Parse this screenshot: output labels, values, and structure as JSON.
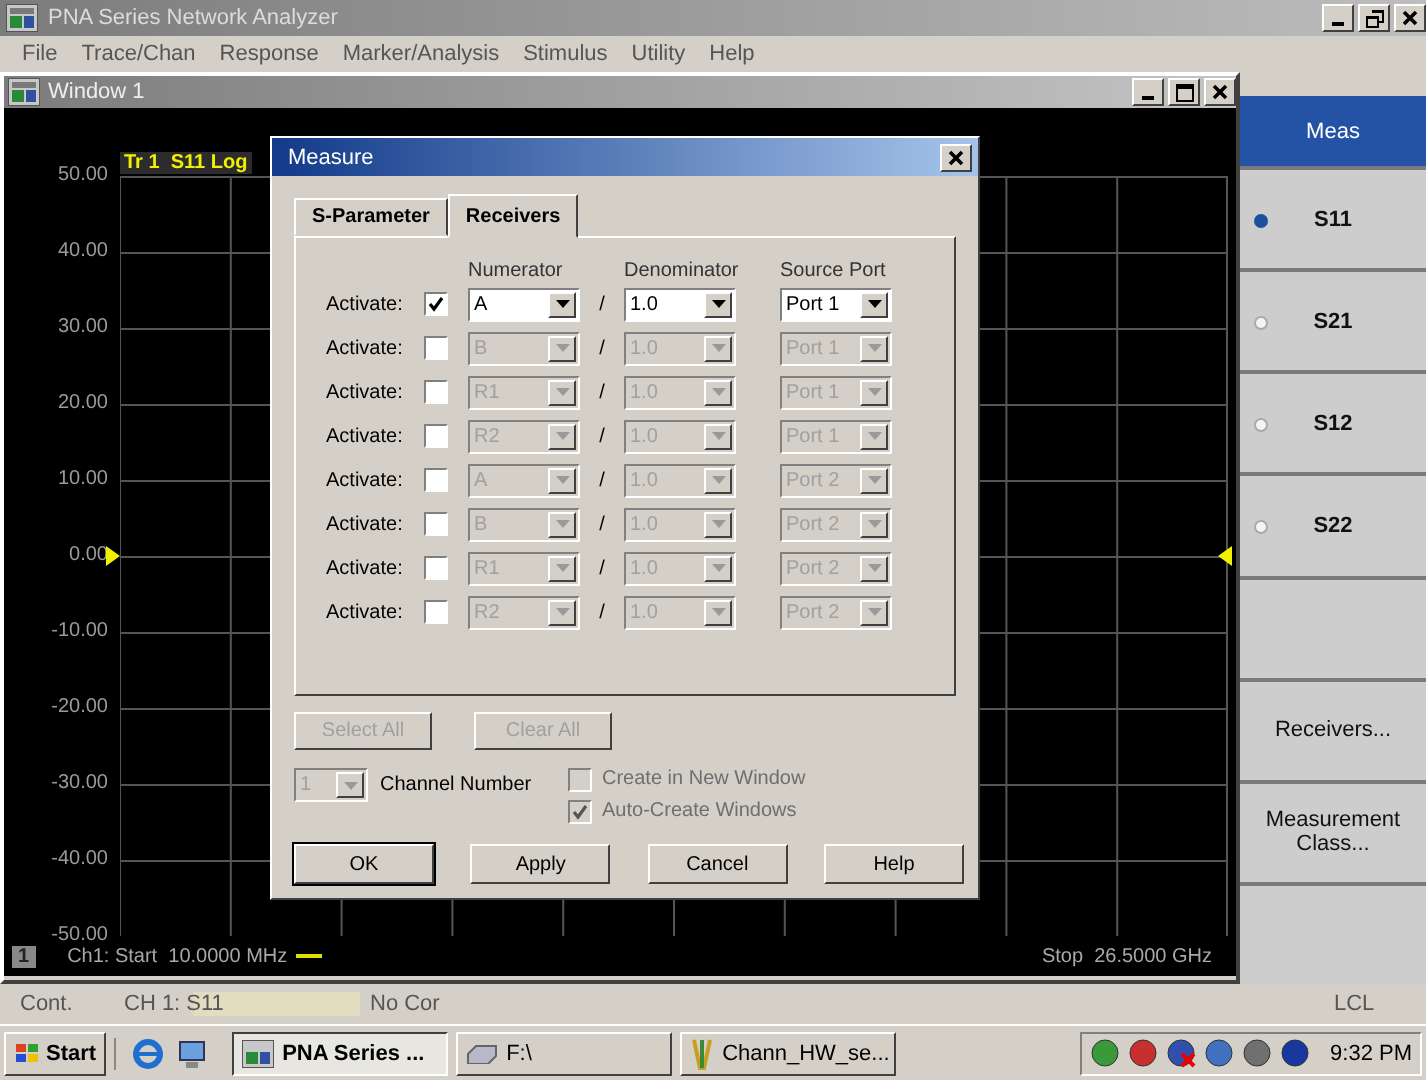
{
  "app": {
    "title": "PNA Series Network Analyzer"
  },
  "menu": [
    "File",
    "Trace/Chan",
    "Response",
    "Marker/Analysis",
    "Stimulus",
    "Utility",
    "Help"
  ],
  "child_window": {
    "title": "Window 1"
  },
  "plot": {
    "trace_label": "Tr 1  S11 Log",
    "y_labels": [
      "50.00",
      "40.00",
      "30.00",
      "20.00",
      "10.00",
      "0.00",
      "-10.00",
      "-20.00",
      "-30.00",
      "-40.00",
      "-50.00"
    ],
    "channel_badge": "1",
    "start": "Ch1: Start  10.0000 MHz",
    "stop": "Stop  26.5000 GHz"
  },
  "dialog": {
    "title": "Measure",
    "tabs": [
      {
        "label": "S-Parameter",
        "selected": false
      },
      {
        "label": "Receivers",
        "selected": true
      }
    ],
    "columns": [
      "Numerator",
      "Denominator",
      "Source Port"
    ],
    "rows": [
      {
        "label": "Activate:",
        "checked": true,
        "disabled": false,
        "numerator": "A",
        "slash": "/",
        "denominator": "1.0",
        "source_port": "Port 1"
      },
      {
        "label": "Activate:",
        "checked": false,
        "disabled": true,
        "numerator": "B",
        "slash": "/",
        "denominator": "1.0",
        "source_port": "Port 1"
      },
      {
        "label": "Activate:",
        "checked": false,
        "disabled": true,
        "numerator": "R1",
        "slash": "/",
        "denominator": "1.0",
        "source_port": "Port 1"
      },
      {
        "label": "Activate:",
        "checked": false,
        "disabled": true,
        "numerator": "R2",
        "slash": "/",
        "denominator": "1.0",
        "source_port": "Port 1"
      },
      {
        "label": "Activate:",
        "checked": false,
        "disabled": true,
        "numerator": "A",
        "slash": "/",
        "denominator": "1.0",
        "source_port": "Port 2"
      },
      {
        "label": "Activate:",
        "checked": false,
        "disabled": true,
        "numerator": "B",
        "slash": "/",
        "denominator": "1.0",
        "source_port": "Port 2"
      },
      {
        "label": "Activate:",
        "checked": false,
        "disabled": true,
        "numerator": "R1",
        "slash": "/",
        "denominator": "1.0",
        "source_port": "Port 2"
      },
      {
        "label": "Activate:",
        "checked": false,
        "disabled": true,
        "numerator": "R2",
        "slash": "/",
        "denominator": "1.0",
        "source_port": "Port 2"
      }
    ],
    "select_buttons": [
      {
        "label": "Select All",
        "disabled": true
      },
      {
        "label": "Clear All",
        "disabled": true
      }
    ],
    "channel": {
      "value": "1",
      "disabled": true,
      "label": "Channel Number"
    },
    "options": [
      {
        "label": "Create in New Window",
        "checked": false,
        "disabled": true
      },
      {
        "label": "Auto-Create Windows",
        "checked": true,
        "disabled": true
      }
    ],
    "buttons": [
      {
        "label": "OK",
        "default": true
      },
      {
        "label": "Apply",
        "default": false
      },
      {
        "label": "Cancel",
        "default": false
      },
      {
        "label": "Help",
        "default": false
      }
    ]
  },
  "softkeys": {
    "header": "Meas",
    "keys": [
      {
        "kind": "radio",
        "label": "S11",
        "selected": true
      },
      {
        "kind": "radio",
        "label": "S21",
        "selected": false
      },
      {
        "kind": "radio",
        "label": "S12",
        "selected": false
      },
      {
        "kind": "radio",
        "label": "S22",
        "selected": false
      },
      {
        "kind": "blank"
      },
      {
        "kind": "button",
        "label": "Receivers..."
      },
      {
        "kind": "button",
        "label": "Measurement Class..."
      },
      {
        "kind": "blank"
      }
    ]
  },
  "status_bar": {
    "mode": "Cont.",
    "measurement": "CH 1: S11",
    "correction": "No Cor",
    "remote": "LCL"
  },
  "taskbar": {
    "start": "Start",
    "tasks": [
      {
        "label": "PNA Series ...",
        "selected": true
      },
      {
        "label": "F:\\",
        "selected": false
      },
      {
        "label": "Chann_HW_se...",
        "selected": false
      }
    ],
    "clock": "9:32 PM"
  }
}
